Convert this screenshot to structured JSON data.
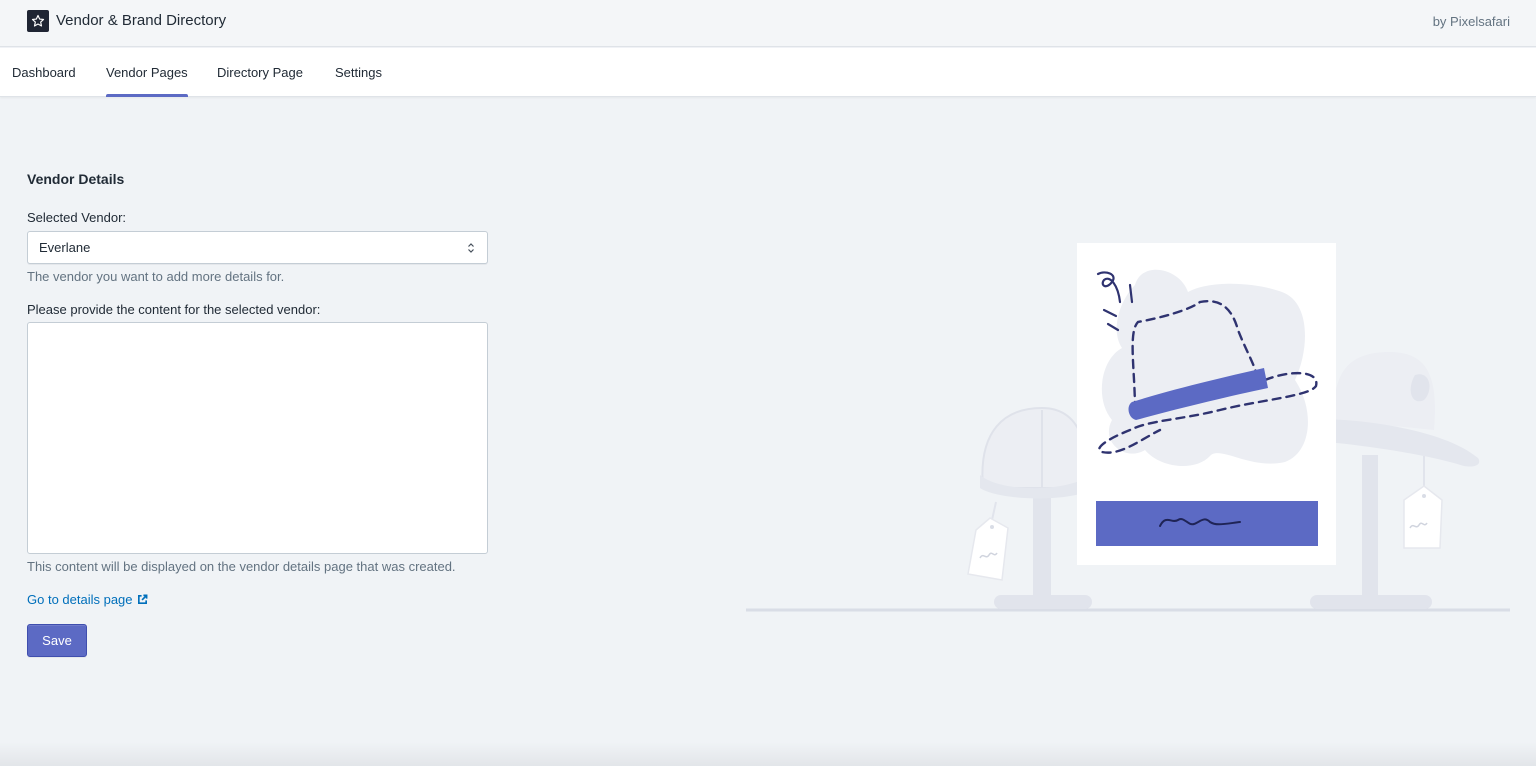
{
  "app": {
    "title": "Vendor & Brand Directory",
    "credit": "by Pixelsafari",
    "logo_icon": "star-icon"
  },
  "nav": {
    "tabs": [
      {
        "label": "Dashboard",
        "active": false
      },
      {
        "label": "Vendor Pages",
        "active": true
      },
      {
        "label": "Directory Page",
        "active": false
      },
      {
        "label": "Settings",
        "active": false
      }
    ]
  },
  "form": {
    "section_title": "Vendor Details",
    "vendor_label": "Selected Vendor:",
    "vendor_value": "Everlane",
    "vendor_help": "The vendor you want to add more details for.",
    "content_label": "Please provide the content for the selected vendor:",
    "content_value": "",
    "content_help": "This content will be displayed on the vendor details page that was created.",
    "details_link": "Go to details page",
    "details_link_icon": "external-link-icon",
    "save_label": "Save"
  },
  "colors": {
    "accent": "#5c6ac4",
    "link": "#006fbb",
    "background": "#f0f3f6"
  }
}
